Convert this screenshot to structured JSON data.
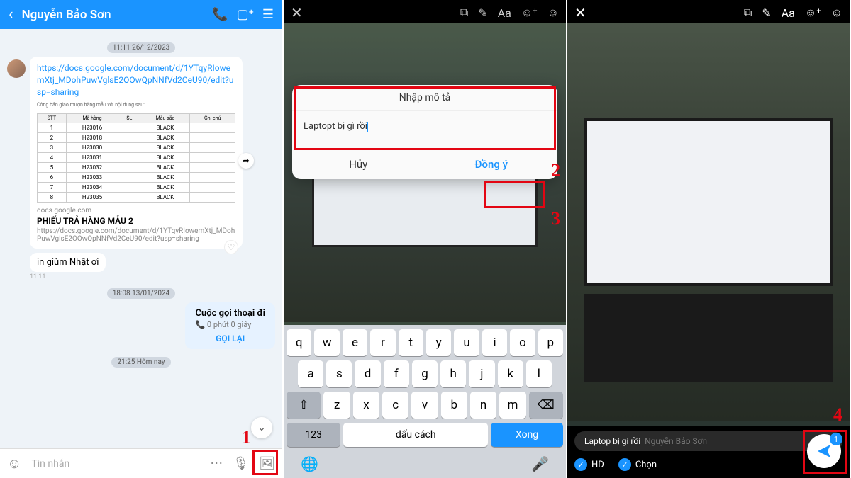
{
  "panel1": {
    "header": {
      "name": "Nguyễn Bảo Sơn"
    },
    "ts1": "11:11 26/12/2023",
    "link": "https://docs.google.com/document/d/1YTqyRIowemXtj_MDohPuwVglsE2OOwQpNNfVd2CeU90/edit?usp=sharing",
    "preview": {
      "caption": "Công bản giao mượn hàng mẫu với nội dung sau:",
      "headers": [
        "STT",
        "Mã hàng",
        "SL",
        "Màu sắc",
        "Ghi chú"
      ],
      "rows": [
        [
          "1",
          "H23016",
          "",
          "BLACK",
          ""
        ],
        [
          "2",
          "H23018",
          "",
          "BLACK",
          ""
        ],
        [
          "3",
          "H23030",
          "",
          "BLACK",
          ""
        ],
        [
          "4",
          "H23031",
          "",
          "BLACK",
          ""
        ],
        [
          "5",
          "H23032",
          "",
          "BLACK",
          ""
        ],
        [
          "6",
          "H23033",
          "",
          "BLACK",
          ""
        ],
        [
          "7",
          "H23034",
          "",
          "BLACK",
          ""
        ],
        [
          "8",
          "H23035",
          "",
          "BLACK",
          ""
        ]
      ],
      "domain": "docs.google.com",
      "title": "PHIẾU TRẢ HÀNG MẪU 2",
      "desc": "https://docs.google.com/document/d/1YTqyRIowemXtj_MDohPuwVglsE2OOwQpNNfVd2CeU90/edit?usp=sharing"
    },
    "msg2": "in giùm Nhật ơi",
    "msg2_time": "11:11",
    "ts2": "18:08 13/01/2024",
    "call": {
      "title": "Cuộc gọi thoại đi",
      "duration": "0 phút 0 giây",
      "action": "GỌI LẠI"
    },
    "ts3": "21:25 Hôm nay",
    "input_placeholder": "Tin nhắn",
    "step": "1"
  },
  "panel2": {
    "dialog": {
      "title": "Nhập mô tả",
      "value": "Laptopt bị gì rồi",
      "cancel": "Hủy",
      "ok": "Đồng ý"
    },
    "kb": {
      "r1": [
        "q",
        "w",
        "e",
        "r",
        "t",
        "y",
        "u",
        "i",
        "o",
        "p"
      ],
      "r2": [
        "a",
        "s",
        "d",
        "f",
        "g",
        "h",
        "j",
        "k",
        "l"
      ],
      "r3_shift": "⇧",
      "r3": [
        "z",
        "x",
        "c",
        "v",
        "b",
        "n",
        "m"
      ],
      "r3_del": "⌫",
      "r4_123": "123",
      "r4_space": "dấu cách",
      "r4_done": "Xong"
    },
    "step2": "2",
    "step3": "3"
  },
  "panel3": {
    "caption": "Laptop bị gì rồi",
    "caption_ph": "Nguyễn Bảo Sơn",
    "opt_hd": "HD",
    "opt_select": "Chọn",
    "badge": "1",
    "step4": "4"
  },
  "editor_tools": {
    "aa": "Aa"
  }
}
